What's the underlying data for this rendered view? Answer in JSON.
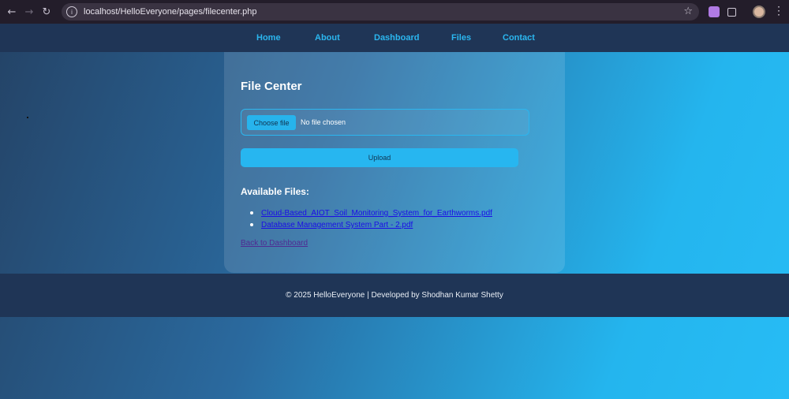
{
  "browser": {
    "url": "localhost/HelloEveryone/pages/filecenter.php",
    "back_icon": "←",
    "forward_icon": "→",
    "reload_icon": "↻",
    "star_icon": "☆",
    "menu_icon": "⋮"
  },
  "nav": {
    "items": [
      "Home",
      "About",
      "Dashboard",
      "Files",
      "Contact"
    ]
  },
  "card": {
    "title": "File Center",
    "choose_file_label": "Choose file",
    "no_file_text": "No file chosen",
    "upload_label": "Upload",
    "available_heading": "Available Files:",
    "files": [
      "Cloud-Based_AIOT_Soil_Monitoring_System_for_Earthworms.pdf",
      "Database Management System Part - 2.pdf"
    ],
    "back_link": "Back to Dashboard"
  },
  "footer": {
    "text": "© 2025 HelloEveryone | Developed by Shodhan Kumar Shetty"
  },
  "colors": {
    "accent": "#27b6f0",
    "nav_bg": "#1f3556",
    "link": "#1a0ee6",
    "visited_link": "#4f2b93"
  }
}
